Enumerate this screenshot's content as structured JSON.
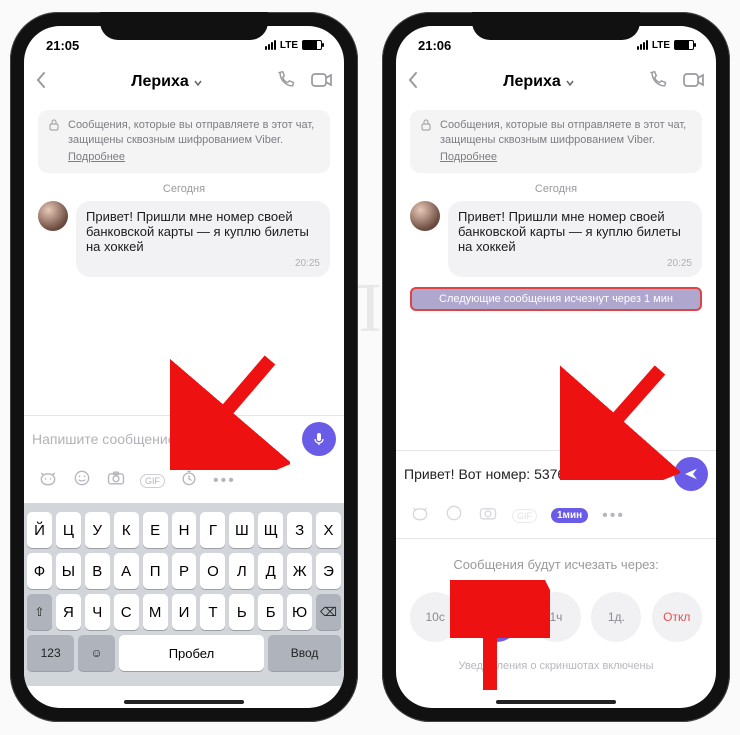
{
  "watermark": "ЯБЛЫК",
  "left": {
    "status": {
      "time": "21:05",
      "net": "LTE"
    },
    "contact": "Лериха",
    "encryption": {
      "text": "Сообщения, которые вы отправляете в этот чат, защищены сквозным шифрованием Viber.",
      "more": "Подробнее"
    },
    "day": "Сегодня",
    "msg": "Привет! Пришли мне номер своей банковской карты — я куплю билеты на хоккей",
    "msgtime": "20:25",
    "placeholder": "Напишите сообщение",
    "gif": "GIF",
    "kbd": {
      "r1": [
        "Й",
        "Ц",
        "У",
        "К",
        "Е",
        "Н",
        "Г",
        "Ш",
        "Щ",
        "З",
        "Х"
      ],
      "r2": [
        "Ф",
        "Ы",
        "В",
        "А",
        "П",
        "Р",
        "О",
        "Л",
        "Д",
        "Ж",
        "Э"
      ],
      "r3": [
        "Я",
        "Ч",
        "С",
        "М",
        "И",
        "Т",
        "Ь",
        "Б",
        "Ю"
      ],
      "numkey": "123",
      "space": "Пробел",
      "enter": "Ввод"
    }
  },
  "right": {
    "status": {
      "time": "21:06",
      "net": "LTE"
    },
    "contact": "Лериха",
    "encryption": {
      "text": "Сообщения, которые вы отправляете в этот чат, защищены сквозным шифрованием Viber.",
      "more": "Подробнее"
    },
    "day": "Сегодня",
    "msg": "Привет! Пришли мне номер своей банковской карты — я куплю билеты на хоккей",
    "msgtime": "20:25",
    "banner": "Следующие сообщения исчезнут через 1 мин",
    "draft": "Привет! Вот номер: 5376434788",
    "activeTimer": "1мин",
    "timer": {
      "label": "Сообщения будут исчезать через:",
      "opts": [
        "10с",
        "1мин",
        "1ч",
        "1д.",
        "Откл"
      ],
      "selectedIndex": 1,
      "note": "Уведомления о скриншотах включены"
    }
  }
}
